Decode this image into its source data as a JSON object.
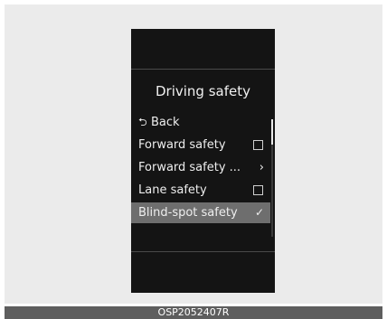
{
  "screen": {
    "title": "Driving safety",
    "back": {
      "icon": "return-arrow-icon",
      "glyph": "⮌",
      "label": "Back"
    },
    "items": [
      {
        "label": "Forward safety",
        "control": "checkbox-icon",
        "checked": false
      },
      {
        "label": "Forward safety ...",
        "control": "chevron-right-icon",
        "glyph": "›"
      },
      {
        "label": "Lane safety",
        "control": "checkbox-icon",
        "checked": false
      },
      {
        "label": "Blind-spot safety",
        "control": "checkmark-icon",
        "glyph": "✓",
        "checked": true,
        "selected": true
      }
    ]
  },
  "caption": "OSP2052407R",
  "colors": {
    "screen_bg": "#141414",
    "selected_row": "#6e6e6e",
    "page_bg": "#ebebeb",
    "caption_bar": "#5e5e5e"
  }
}
